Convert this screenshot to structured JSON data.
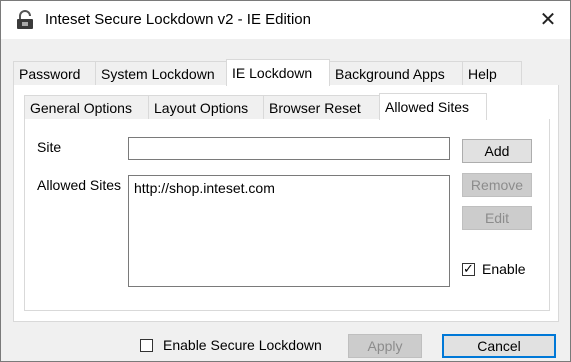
{
  "window": {
    "title": "Inteset Secure Lockdown v2 - IE Edition",
    "close_glyph": "✕"
  },
  "main_tabs": [
    {
      "label": "Password",
      "active": false
    },
    {
      "label": "System Lockdown",
      "active": false
    },
    {
      "label": "IE Lockdown",
      "active": true
    },
    {
      "label": "Background Apps",
      "active": false
    },
    {
      "label": "Help",
      "active": false
    }
  ],
  "sub_tabs": [
    {
      "label": "General Options",
      "active": false
    },
    {
      "label": "Layout Options",
      "active": false
    },
    {
      "label": "Browser Reset",
      "active": false
    },
    {
      "label": "Allowed Sites",
      "active": true
    }
  ],
  "allowed_sites_panel": {
    "site_label": "Site",
    "site_value": "",
    "allowed_sites_label": "Allowed Sites",
    "allowed_sites": [
      "http://shop.inteset.com"
    ],
    "add_label": "Add",
    "remove_label": "Remove",
    "edit_label": "Edit",
    "enable_label": "Enable",
    "enable_checked": true
  },
  "footer": {
    "enable_secure_lockdown_label": "Enable Secure Lockdown",
    "enable_secure_lockdown_checked": false,
    "apply_label": "Apply",
    "cancel_label": "Cancel"
  },
  "colors": {
    "accent": "#0078d7",
    "window_bg": "#f0f0f0",
    "disabled_text": "#8c8c8c"
  }
}
